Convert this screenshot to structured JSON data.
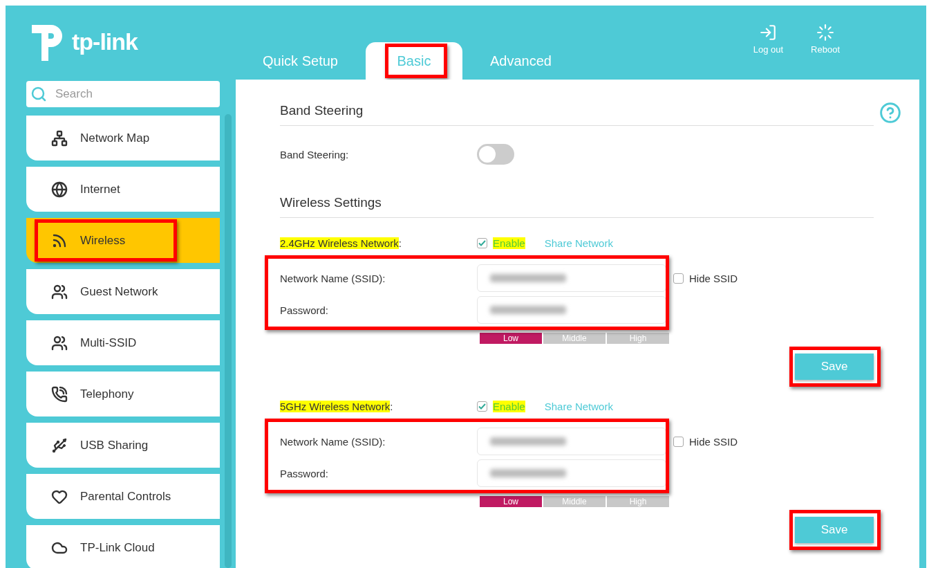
{
  "logo": {
    "text": "tp-link"
  },
  "tabs": [
    {
      "label": "Quick Setup",
      "selected": false,
      "annotated": false
    },
    {
      "label": "Basic",
      "selected": true,
      "annotated": true
    },
    {
      "label": "Advanced",
      "selected": false,
      "annotated": false
    }
  ],
  "header_actions": [
    {
      "kind": "logout",
      "label": "Log out"
    },
    {
      "kind": "reboot",
      "label": "Reboot"
    }
  ],
  "search": {
    "placeholder": "Search"
  },
  "sidebar": {
    "items": [
      {
        "kind": "network-map",
        "label": "Network Map",
        "selected": false,
        "annotated": false
      },
      {
        "kind": "internet",
        "label": "Internet",
        "selected": false,
        "annotated": false
      },
      {
        "kind": "wireless",
        "label": "Wireless",
        "selected": true,
        "annotated": true
      },
      {
        "kind": "guest",
        "label": "Guest Network",
        "selected": false,
        "annotated": false
      },
      {
        "kind": "multi-ssid",
        "label": "Multi-SSID",
        "selected": false,
        "annotated": false
      },
      {
        "kind": "telephony",
        "label": "Telephony",
        "selected": false,
        "annotated": false
      },
      {
        "kind": "usb",
        "label": "USB Sharing",
        "selected": false,
        "annotated": false
      },
      {
        "kind": "parental",
        "label": "Parental Controls",
        "selected": false,
        "annotated": false
      },
      {
        "kind": "cloud",
        "label": "TP-Link Cloud",
        "selected": false,
        "annotated": false
      }
    ]
  },
  "band_steering": {
    "title": "Band Steering",
    "label": "Band Steering:",
    "on": false
  },
  "wireless_settings": {
    "title": "Wireless Settings",
    "networks": [
      {
        "label": "2.4GHz Wireless Network",
        "label_end": ":",
        "highlighted": true,
        "enable": {
          "label": "Enable",
          "checked": true,
          "highlighted": true
        },
        "share": "Share Network",
        "fields": [
          {
            "label": "Network Name (SSID):",
            "blurred": true
          },
          {
            "label": "Password:",
            "blurred": true
          }
        ],
        "fields_annotated": true,
        "hide_ssid": {
          "label": "Hide SSID",
          "checked": false
        },
        "strength": [
          {
            "label": "Low",
            "selected": true
          },
          {
            "label": "Middle",
            "selected": false
          },
          {
            "label": "High",
            "selected": false
          }
        ],
        "save": {
          "label": "Save",
          "annotated": true
        }
      },
      {
        "label": "5GHz Wireless Network",
        "label_end": ":",
        "highlighted": true,
        "enable": {
          "label": "Enable",
          "checked": true,
          "highlighted": true
        },
        "share": "Share Network",
        "fields": [
          {
            "label": "Network Name (SSID):",
            "blurred": true
          },
          {
            "label": "Password:",
            "blurred": true
          }
        ],
        "fields_annotated": true,
        "hide_ssid": {
          "label": "Hide SSID",
          "checked": false
        },
        "strength": [
          {
            "label": "Low",
            "selected": true
          },
          {
            "label": "Middle",
            "selected": false
          },
          {
            "label": "High",
            "selected": false
          }
        ],
        "save": {
          "label": "Save",
          "annotated": true
        }
      }
    ]
  }
}
